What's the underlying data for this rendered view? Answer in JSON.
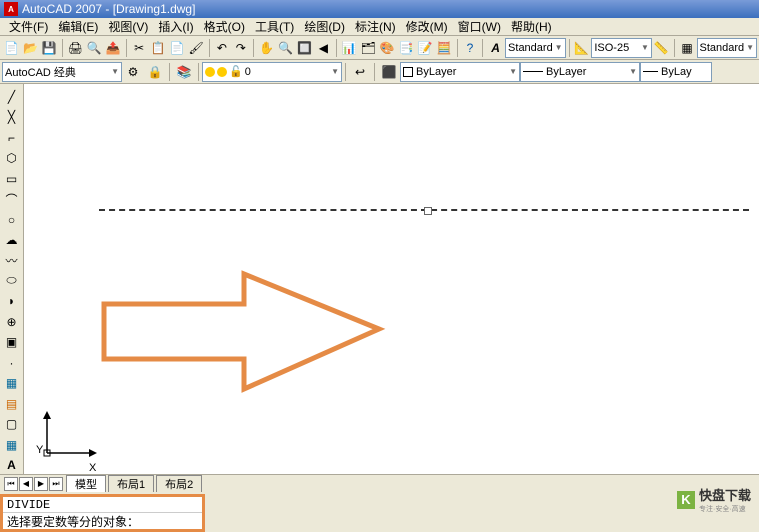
{
  "titlebar": {
    "title": "AutoCAD 2007 - [Drawing1.dwg]"
  },
  "menus": {
    "file": "文件(F)",
    "edit": "编辑(E)",
    "view": "视图(V)",
    "insert": "插入(I)",
    "format": "格式(O)",
    "tools": "工具(T)",
    "draw": "绘图(D)",
    "dimension": "标注(N)",
    "modify": "修改(M)",
    "window": "窗口(W)",
    "help": "帮助(H)"
  },
  "toolbar1": {
    "standard": "Standard",
    "iso25": "ISO-25",
    "standard2": "Standard"
  },
  "toolbar2": {
    "workspace": "AutoCAD 经典",
    "layer": "0",
    "bylayer1": "ByLayer",
    "bylayer2": "ByLayer",
    "bylayer3": "ByLay"
  },
  "canvas": {
    "ucs_x": "X",
    "ucs_y": "Y"
  },
  "tabs": {
    "model": "模型",
    "layout1": "布局1",
    "layout2": "布局2"
  },
  "cmdline": {
    "line1": "DIVIDE",
    "line2": "选择要定数等分的对象："
  },
  "watermark": {
    "name": "快盘下载",
    "sub": "专注·安全·高速"
  }
}
